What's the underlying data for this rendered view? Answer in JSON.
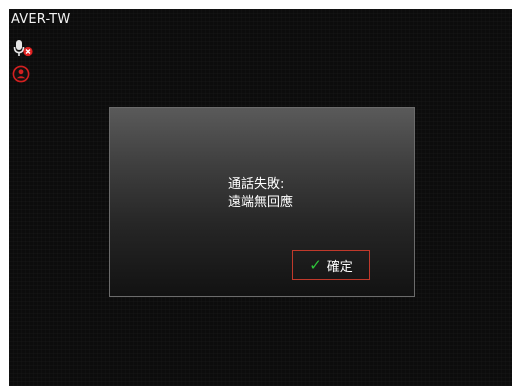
{
  "screen": {
    "site_name": "AVER-TW",
    "mic_icon": "microphone-muted-icon",
    "user_icon": "user-circle-icon"
  },
  "dialog": {
    "line1": "通話失敗:",
    "line2": "遠端無回應",
    "confirm_label": "確定",
    "confirm_icon": "check-icon"
  },
  "colors": {
    "background": "#0c0c0c",
    "mute_badge": "#e02020",
    "user_icon": "#d32020",
    "button_border": "#c0392b",
    "check": "#2ec53a"
  }
}
